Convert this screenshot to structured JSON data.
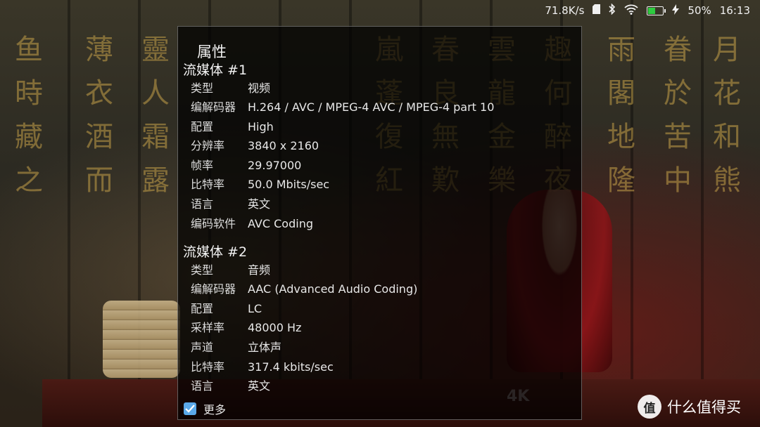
{
  "status_bar": {
    "net_speed": "71.8K/s",
    "battery_percent": "50%",
    "battery_level": 0.5,
    "time": "16:13",
    "icons": [
      "sd-card-icon",
      "bluetooth-icon",
      "wifi-icon",
      "battery-icon",
      "charging-icon"
    ]
  },
  "dialog": {
    "title": "属性",
    "streams": [
      {
        "header": "流媒体 #1",
        "rows": [
          {
            "k": "类型",
            "v": "视频"
          },
          {
            "k": "编解码器",
            "v": "H.264 / AVC / MPEG-4 AVC / MPEG-4 part 10"
          },
          {
            "k": "配置",
            "v": "High"
          },
          {
            "k": "分辨率",
            "v": "3840 x 2160"
          },
          {
            "k": "帧率",
            "v": "29.97000"
          },
          {
            "k": "比特率",
            "v": "50.0 Mbits/sec"
          },
          {
            "k": "语言",
            "v": "英文"
          },
          {
            "k": "编码软件",
            "v": "AVC Coding"
          }
        ]
      },
      {
        "header": "流媒体 #2",
        "rows": [
          {
            "k": "类型",
            "v": "音频"
          },
          {
            "k": "编解码器",
            "v": "AAC (Advanced Audio Coding)"
          },
          {
            "k": "配置",
            "v": "LC"
          },
          {
            "k": "采样率",
            "v": "48000 Hz"
          },
          {
            "k": "声道",
            "v": "立体声"
          },
          {
            "k": "比特率",
            "v": "317.4 kbits/sec"
          },
          {
            "k": "语言",
            "v": "英文"
          }
        ]
      }
    ],
    "more_label": "更多",
    "more_checked": true
  },
  "background": {
    "logo_text": "4K",
    "glyphs": [
      "鱼",
      "時",
      "藏",
      "之",
      "薄",
      "衣",
      "酒",
      "而",
      "靈",
      "人",
      "霜",
      "露",
      "嵐",
      "蓬",
      "復",
      "紅",
      "春",
      "良",
      "無",
      "歎",
      "雲",
      "龍",
      "金",
      "樂",
      "趣",
      "何",
      "醉",
      "夜",
      "雨",
      "閣",
      "地",
      "隆",
      "眷",
      "於",
      "苦",
      "中",
      "月",
      "花",
      "和",
      "熊"
    ]
  },
  "brand": {
    "badge": "值",
    "name": "什么值得买"
  },
  "colors": {
    "accent": "#5aa9ea",
    "battery_fill": "#2ecc40",
    "dialog_bg": "rgba(0,0,0,0.72)"
  }
}
